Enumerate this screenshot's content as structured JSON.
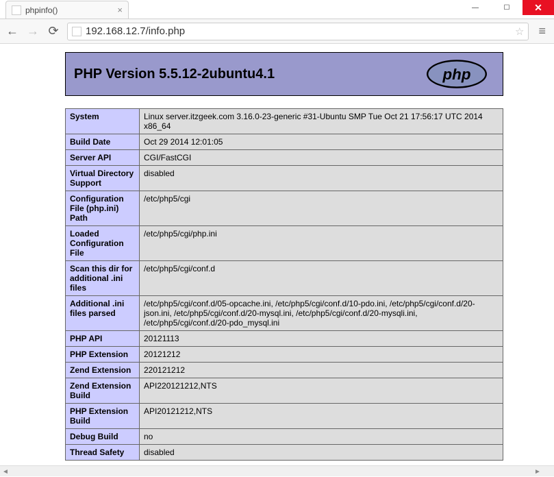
{
  "window": {
    "tab_title": "phpinfo()",
    "url": "192.168.12.7/info.php"
  },
  "header": {
    "title": "PHP Version 5.5.12-2ubuntu4.1",
    "logo_text": "php"
  },
  "rows": [
    {
      "key": "System",
      "val": "Linux server.itzgeek.com 3.16.0-23-generic #31-Ubuntu SMP Tue Oct 21 17:56:17 UTC 2014 x86_64"
    },
    {
      "key": "Build Date",
      "val": "Oct 29 2014 12:01:05"
    },
    {
      "key": "Server API",
      "val": "CGI/FastCGI"
    },
    {
      "key": "Virtual Directory Support",
      "val": "disabled"
    },
    {
      "key": "Configuration File (php.ini) Path",
      "val": "/etc/php5/cgi"
    },
    {
      "key": "Loaded Configuration File",
      "val": "/etc/php5/cgi/php.ini"
    },
    {
      "key": "Scan this dir for additional .ini files",
      "val": "/etc/php5/cgi/conf.d"
    },
    {
      "key": "Additional .ini files parsed",
      "val": "/etc/php5/cgi/conf.d/05-opcache.ini, /etc/php5/cgi/conf.d/10-pdo.ini, /etc/php5/cgi/conf.d/20-json.ini, /etc/php5/cgi/conf.d/20-mysql.ini, /etc/php5/cgi/conf.d/20-mysqli.ini, /etc/php5/cgi/conf.d/20-pdo_mysql.ini"
    },
    {
      "key": "PHP API",
      "val": "20121113"
    },
    {
      "key": "PHP Extension",
      "val": "20121212"
    },
    {
      "key": "Zend Extension",
      "val": "220121212"
    },
    {
      "key": "Zend Extension Build",
      "val": "API220121212,NTS"
    },
    {
      "key": "PHP Extension Build",
      "val": "API20121212,NTS"
    },
    {
      "key": "Debug Build",
      "val": "no"
    },
    {
      "key": "Thread Safety",
      "val": "disabled"
    }
  ]
}
